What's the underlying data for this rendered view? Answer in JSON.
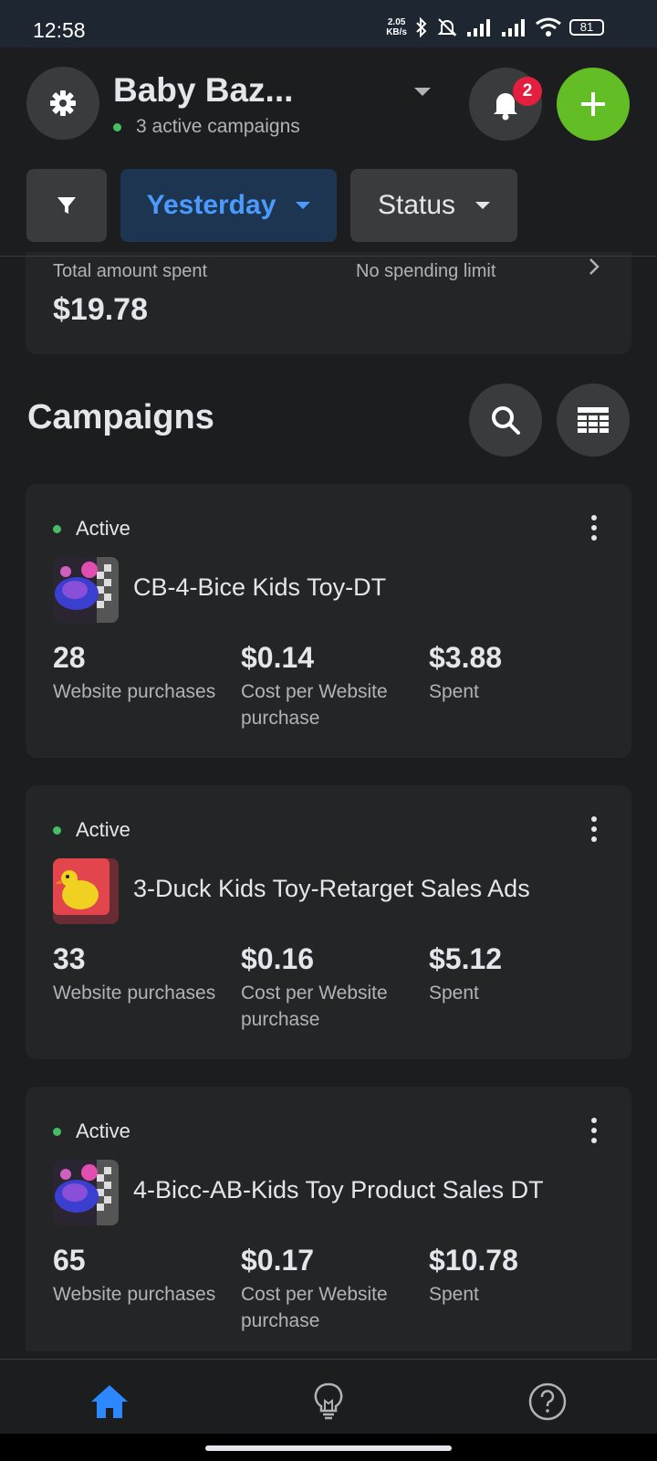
{
  "status_bar": {
    "time": "12:58",
    "network_speed_value": "2.05",
    "network_speed_unit": "KB/s",
    "battery": "81"
  },
  "header": {
    "account_name": "Baby Baz...",
    "active_campaigns": "3 active campaigns",
    "notification_count": "2"
  },
  "filters": {
    "date_label": "Yesterday",
    "status_label": "Status"
  },
  "summary": {
    "total_label": "Total amount spent",
    "total_value": "$19.78",
    "limit_label": "No spending limit"
  },
  "campaigns_section": {
    "title": "Campaigns"
  },
  "campaigns": [
    {
      "status": "Active",
      "name": "CB-4-Bice Kids Toy-DT",
      "purchases": "28",
      "purchases_label": "Website purchases",
      "cost": "$0.14",
      "cost_label_1": "Cost per Website",
      "cost_label_2": "purchase",
      "spent": "$3.88",
      "spent_label": "Spent"
    },
    {
      "status": "Active",
      "name": "3-Duck Kids Toy-Retarget Sales Ads",
      "purchases": "33",
      "purchases_label": "Website purchases",
      "cost": "$0.16",
      "cost_label_1": "Cost per Website",
      "cost_label_2": "purchase",
      "spent": "$5.12",
      "spent_label": "Spent"
    },
    {
      "status": "Active",
      "name": "4-Bicc-AB-Kids Toy Product Sales DT",
      "purchases": "65",
      "purchases_label": "Website purchases",
      "cost": "$0.17",
      "cost_label_1": "Cost per Website",
      "cost_label_2": "purchase",
      "spent": "$10.78",
      "spent_label": "Spent"
    }
  ],
  "colors": {
    "background": "#1c1d1f",
    "card": "#242526",
    "accent_blue": "#4b9bff",
    "add_button_green": "#63be25",
    "active_dot": "#45bd62",
    "badge_red": "#e41e3f"
  },
  "icons": {
    "settings": "gear-icon",
    "notifications": "bell-icon",
    "add": "plus-icon",
    "filter": "filter-icon",
    "search": "search-icon",
    "columns": "table-icon",
    "home": "home-icon",
    "tips": "lightbulb-icon",
    "help": "help-icon"
  }
}
